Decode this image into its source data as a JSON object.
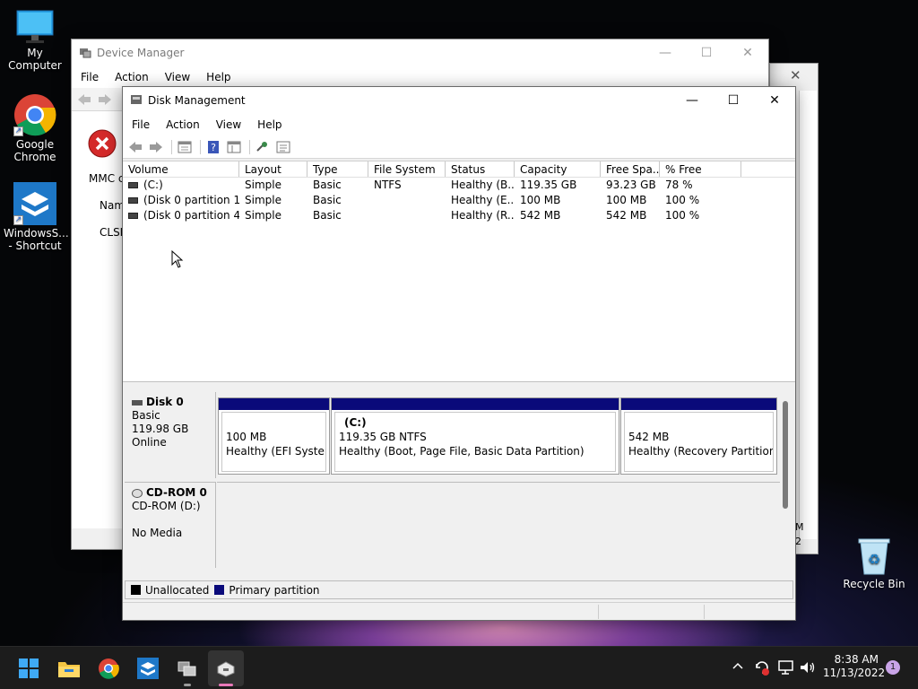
{
  "desktop": {
    "icons": [
      {
        "label": "My Computer"
      },
      {
        "label": "Google Chrome"
      },
      {
        "label": "WindowsS... - Shortcut"
      },
      {
        "label": "Recycle Bin"
      }
    ]
  },
  "device_manager": {
    "title": "Device Manager",
    "menu": [
      "File",
      "Action",
      "View",
      "Help"
    ],
    "partial_texts": [
      "MMC c",
      "Nam",
      "CLSI"
    ],
    "right_partial": [
      "M",
      "2"
    ]
  },
  "disk_management": {
    "title": "Disk Management",
    "menu": [
      "File",
      "Action",
      "View",
      "Help"
    ],
    "columns": [
      "Volume",
      "Layout",
      "Type",
      "File System",
      "Status",
      "Capacity",
      "Free Spa...",
      "% Free"
    ],
    "rows": [
      {
        "volume": "(C:)",
        "layout": "Simple",
        "type": "Basic",
        "fs": "NTFS",
        "status": "Healthy (B...",
        "capacity": "119.35 GB",
        "free": "93.23 GB",
        "pct": "78 %"
      },
      {
        "volume": "(Disk 0 partition 1)",
        "layout": "Simple",
        "type": "Basic",
        "fs": "",
        "status": "Healthy (E...",
        "capacity": "100 MB",
        "free": "100 MB",
        "pct": "100 %"
      },
      {
        "volume": "(Disk 0 partition 4)",
        "layout": "Simple",
        "type": "Basic",
        "fs": "",
        "status": "Healthy (R...",
        "capacity": "542 MB",
        "free": "542 MB",
        "pct": "100 %"
      }
    ],
    "disk0": {
      "name": "Disk 0",
      "type": "Basic",
      "size": "119.98 GB",
      "status": "Online"
    },
    "partitions": [
      {
        "title": "",
        "line1": "100 MB",
        "line2": "Healthy (EFI System P"
      },
      {
        "title": "(C:)",
        "line1": "119.35 GB NTFS",
        "line2": "Healthy (Boot, Page File, Basic Data Partition)"
      },
      {
        "title": "",
        "line1": "542 MB",
        "line2": "Healthy (Recovery Partition)"
      }
    ],
    "cdrom": {
      "name": "CD-ROM 0",
      "drive": "CD-ROM (D:)",
      "media": "No Media"
    },
    "legend": {
      "unallocated": "Unallocated",
      "primary": "Primary partition"
    },
    "colors": {
      "unallocated": "#000000",
      "primary": "#0a0a7a"
    }
  },
  "taskbar": {
    "time": "8:38 AM",
    "date": "11/13/2022",
    "notification_count": "1"
  }
}
